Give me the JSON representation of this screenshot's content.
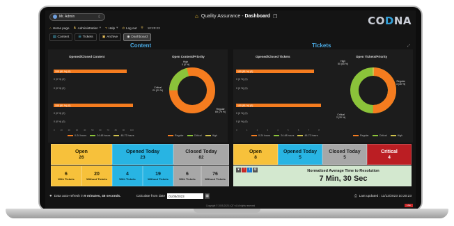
{
  "header": {
    "user": "Mr. Admin",
    "app_title": "Quality Assurance - ",
    "app_title_bold": "Dashboard",
    "logo_left": "CO",
    "logo_mid": "D",
    "logo_right": "NA"
  },
  "nav": {
    "items": [
      "Home page",
      "Administration",
      "Help",
      "Log out"
    ],
    "time": "10:20:23"
  },
  "tabs": [
    "Content",
    "Tickets",
    "Archive",
    "Dashboard"
  ],
  "content": {
    "title": "Content",
    "bar_chart": {
      "title": "Opened/Closed Content",
      "rows": [
        "0 (0 %) (0)",
        "0 (0 %) (0)",
        "0 (0 %) (0)",
        "0 (0 %) (0)",
        "0 (0 %) (0)"
      ],
      "bar1_label": "100 (81 %) (0)",
      "bar2_label": "100 (81 %) (0)",
      "ticks": [
        "0",
        "10",
        "20",
        "30",
        "40",
        "50",
        "60",
        "70",
        "80",
        "90",
        "100"
      ],
      "legend": [
        "0-24 hours",
        "24-48 hours",
        "48-72 hours"
      ]
    },
    "donut": {
      "title": "Open Content/Priority",
      "label_high": "High\n0 (0 %)",
      "label_critical": "Critical\n21 (21 %)",
      "label_regular": "Regular\n69 (79 %)",
      "legend": [
        "Regular",
        "Critical",
        "High"
      ]
    }
  },
  "tickets": {
    "title": "Tickets",
    "bar_chart": {
      "title": "Opened/Closed Tickets",
      "rows": [
        "0 (0 %) (0)",
        "0 (0 %) (0)",
        "0 (0 %) (0)",
        "0 (0 %) (0)",
        "0 (0 %) (0)"
      ],
      "bar1_label": "100 (81 %) (0)",
      "bar2_label": "100 (81 %) (0)",
      "ticks": [
        "0",
        "1",
        "2",
        "3",
        "4",
        "5",
        "6",
        "7",
        "8"
      ],
      "legend": [
        "0-24 hours",
        "24-48 hours",
        "48-72 hours"
      ]
    },
    "donut": {
      "title": "Open Tickets/Priority",
      "label_high": "High\n50 (50 %)",
      "label_regular": "Regular\n3 (30 %)",
      "label_critical": "Critical\n2 (20 %)",
      "legend": [
        "Regular",
        "Critical",
        "High"
      ]
    }
  },
  "content_tiles": {
    "open_label": "Open",
    "open_value": "26",
    "opened_today_label": "Opened Today",
    "opened_today_value": "23",
    "closed_today_label": "Closed Today",
    "closed_today_value": "82",
    "mini": [
      {
        "value": "6",
        "label": "With Tickets"
      },
      {
        "value": "20",
        "label": "Without Tickets"
      },
      {
        "value": "4",
        "label": "With Tickets"
      },
      {
        "value": "19",
        "label": "Without Tickets"
      },
      {
        "value": "6",
        "label": "With Tickets"
      },
      {
        "value": "76",
        "label": "Without Tickets"
      }
    ]
  },
  "ticket_tiles": {
    "open_label": "Open",
    "open_value": "8",
    "opened_today_label": "Opened Today",
    "opened_today_value": "5",
    "closed_today_label": "Closed Today",
    "closed_today_value": "5",
    "critical_label": "Critical",
    "critical_value": "4",
    "resolution_label": "Normalized Average Time to Resolution",
    "resolution_value": "7 Min, 30 Sec"
  },
  "status": {
    "refresh_prefix": "Data auto-refresh in ",
    "refresh_time": "9 minutes, 46 seconds.",
    "calc_label": "Calculate from date",
    "date_value": "01/09/2023",
    "last_updated": "Last updated : 11/12/2023 10:20:23"
  },
  "footer": {
    "copyright": "Copyright © 2005-2023 | QT v4 All rights reserved",
    "badge": "Live"
  },
  "colors": {
    "accent": "#49a9e3",
    "orange": "#f57c1f",
    "green": "#8bc33a",
    "yellow": "#f7c13b",
    "blue": "#28b4e3",
    "grey": "#a7a7a7",
    "red": "#bb1e23"
  }
}
